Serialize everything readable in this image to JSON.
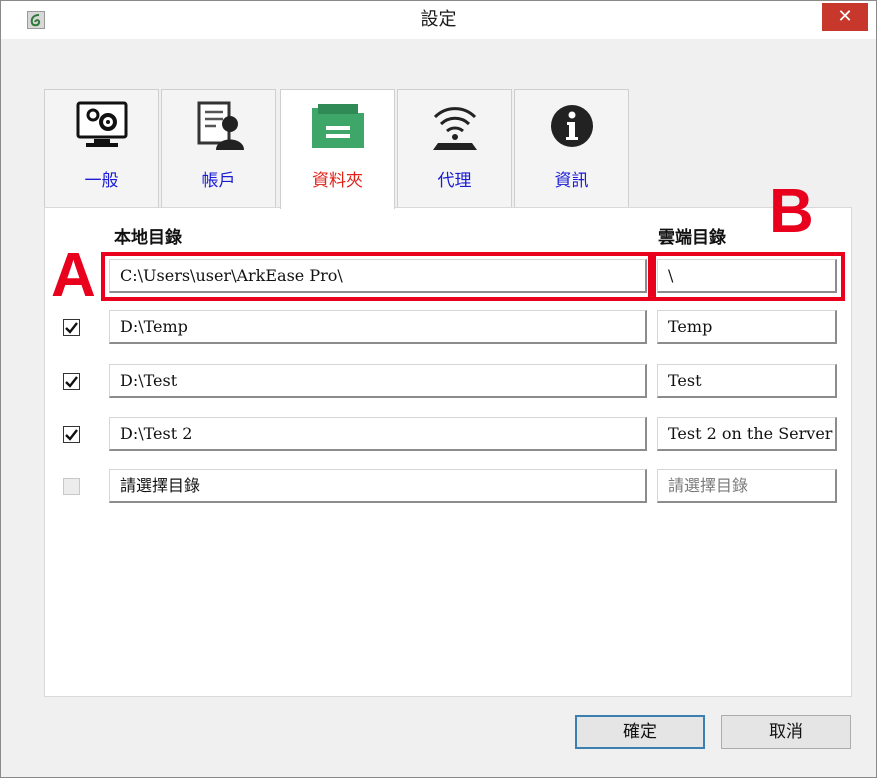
{
  "window": {
    "title": "設定",
    "close_label": "✕"
  },
  "tabs": [
    {
      "label": "一般",
      "icon": "monitor-gear-icon",
      "active": false
    },
    {
      "label": "帳戶",
      "icon": "account-icon",
      "active": false
    },
    {
      "label": "資料夾",
      "icon": "folder-icon",
      "active": true
    },
    {
      "label": "代理",
      "icon": "wifi-proxy-icon",
      "active": false
    },
    {
      "label": "資訊",
      "icon": "info-icon",
      "active": false
    }
  ],
  "folders": {
    "local_header": "本地目錄",
    "remote_header": "雲端目錄",
    "rows": [
      {
        "checked": null,
        "local": "C:\\Users\\user\\ArkEase Pro\\",
        "remote": "\\"
      },
      {
        "checked": true,
        "local": "D:\\Temp",
        "remote": "Temp"
      },
      {
        "checked": true,
        "local": "D:\\Test",
        "remote": "Test"
      },
      {
        "checked": true,
        "local": "D:\\Test 2",
        "remote": "Test 2 on the Server"
      },
      {
        "checked": false,
        "local": "請選擇目錄",
        "remote": "請選擇目錄"
      }
    ]
  },
  "annotations": {
    "marker_a": "A",
    "marker_b": "B",
    "highlight_color": "#e8001c"
  },
  "buttons": {
    "ok": "確定",
    "cancel": "取消"
  },
  "colors": {
    "tab_label": "#1b1bd6",
    "tab_label_active": "#e0221a",
    "close_button": "#c7372b",
    "folder_icon": "#3fa66a"
  }
}
